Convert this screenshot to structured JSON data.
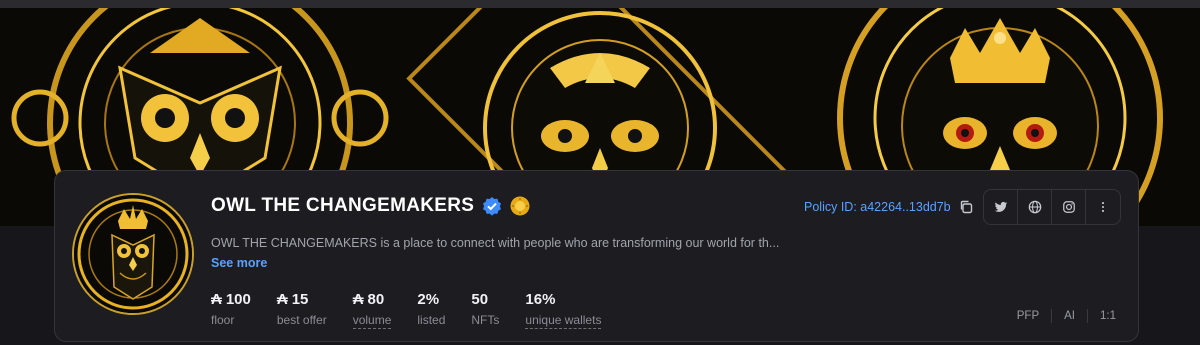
{
  "collection": {
    "name": "OWL THE CHANGEMAKERS",
    "description": "OWL THE CHANGEMAKERS is a place to connect with people who are transforming our world for th...",
    "see_more": "See more",
    "policy_id": "Policy ID: a42264..13dd7b"
  },
  "stats": [
    {
      "currency": "₳",
      "value": "100",
      "label": "floor"
    },
    {
      "currency": "₳",
      "value": "15",
      "label": "best offer"
    },
    {
      "currency": "₳",
      "value": "80",
      "label": "volume"
    },
    {
      "currency": "",
      "value": "2%",
      "label": "listed"
    },
    {
      "currency": "",
      "value": "50",
      "label": "NFTs"
    },
    {
      "currency": "",
      "value": "16%",
      "label": "unique wallets"
    }
  ],
  "tags": [
    "PFP",
    "AI",
    "1:1"
  ],
  "icons": {
    "verified": "verified-check-icon",
    "sun_badge": "sun-badge-icon",
    "copy": "copy-icon",
    "twitter": "twitter-icon",
    "website": "globe-icon",
    "instagram": "instagram-icon",
    "more": "more-vertical-icon"
  },
  "colors": {
    "link": "#5aa2ff",
    "gold": "#e7b322",
    "card_bg": "#1c1c21"
  }
}
